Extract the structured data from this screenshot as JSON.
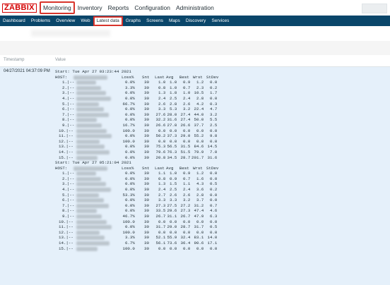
{
  "app": {
    "logo": "ZABBIX"
  },
  "top_menu": [
    "Monitoring",
    "Inventory",
    "Reports",
    "Configuration",
    "Administration"
  ],
  "sub_menu": [
    "Dashboard",
    "Problems",
    "Overview",
    "Web",
    "Latest data",
    "Graphs",
    "Screens",
    "Maps",
    "Discovery",
    "Services"
  ],
  "table": {
    "headers": [
      "Timestamp",
      "Value"
    ],
    "timestamp": "04/27/2021 04:37:09 PM"
  },
  "report": {
    "columns_header": {
      "host": "HOST:",
      "loss": "Loss%",
      "snt": "Snt",
      "last": "Last",
      "avg": "Avg",
      "best": "Best",
      "wrst": "Wrst",
      "stdev": "StDev"
    },
    "blocks": [
      {
        "start": "Start: Tue Apr 27 03:23:44 2021",
        "rows": [
          [
            "1.|--",
            "0.0%",
            "30",
            "1.0",
            "1.0",
            "0.9",
            "1.2",
            "0.0"
          ],
          [
            "2.|--",
            "3.3%",
            "30",
            "0.8",
            "1.0",
            "0.7",
            "2.3",
            "0.2"
          ],
          [
            "3.|--",
            "0.0%",
            "30",
            "1.3",
            "1.8",
            "1.0",
            "10.5",
            "1.7"
          ],
          [
            "4.|--",
            "0.0%",
            "30",
            "2.4",
            "2.5",
            "2.4",
            "2.8",
            "0.0"
          ],
          [
            "5.|--",
            "66.7%",
            "30",
            "2.6",
            "2.8",
            "2.6",
            "4.2",
            "0.3"
          ],
          [
            "6.|--",
            "0.0%",
            "30",
            "3.3",
            "5.3",
            "3.2",
            "22.4",
            "4.7"
          ],
          [
            "7.|--",
            "0.0%",
            "30",
            "27.6",
            "28.0",
            "27.4",
            "44.0",
            "3.2"
          ],
          [
            "8.|--",
            "0.0%",
            "30",
            "32.2",
            "31.6",
            "27.4",
            "50.0",
            "5.5"
          ],
          [
            "9.|--",
            "16.7%",
            "30",
            "26.6",
            "27.8",
            "26.6",
            "37.7",
            "2.5"
          ],
          [
            "10.|--",
            "100.0",
            "30",
            "0.0",
            "0.0",
            "0.0",
            "0.0",
            "0.0"
          ],
          [
            "11.|--",
            "0.0%",
            "30",
            "50.2",
            "37.3",
            "29.0",
            "55.2",
            "9.8"
          ],
          [
            "12.|--",
            "100.0",
            "30",
            "0.0",
            "0.0",
            "0.0",
            "0.0",
            "0.0"
          ],
          [
            "13.|--",
            "0.0%",
            "30",
            "75.3",
            "56.5",
            "31.5",
            "84.6",
            "14.5"
          ],
          [
            "14.|--",
            "0.0%",
            "30",
            "79.6",
            "76.3",
            "51.5",
            "79.9",
            "7.0"
          ],
          [
            "15.|--",
            "0.0%",
            "30",
            "20.8",
            "34.5",
            "28.7",
            "201.7",
            "31.6"
          ]
        ]
      },
      {
        "start": "Start: Tue Apr 27 05:21:04 2021",
        "rows": [
          [
            "1.|--",
            "0.0%",
            "30",
            "1.1",
            "1.0",
            "0.9",
            "1.2",
            "0.0"
          ],
          [
            "2.|--",
            "0.0%",
            "30",
            "0.8",
            "0.9",
            "0.7",
            "1.6",
            "0.0"
          ],
          [
            "3.|--",
            "0.0%",
            "30",
            "1.3",
            "1.5",
            "1.1",
            "4.3",
            "0.5"
          ],
          [
            "4.|--",
            "0.0%",
            "30",
            "2.4",
            "2.5",
            "2.4",
            "3.6",
            "0.2"
          ],
          [
            "5.|--",
            "53.3%",
            "30",
            "2.7",
            "2.6",
            "2.6",
            "2.8",
            "0.0"
          ],
          [
            "6.|--",
            "0.0%",
            "30",
            "3.3",
            "3.3",
            "3.2",
            "3.7",
            "0.0"
          ],
          [
            "7.|--",
            "0.0%",
            "30",
            "27.3",
            "27.5",
            "27.2",
            "31.2",
            "0.7"
          ],
          [
            "8.|--",
            "0.0%",
            "30",
            "33.5",
            "29.6",
            "27.3",
            "47.4",
            "4.6"
          ],
          [
            "9.|--",
            "46.7%",
            "30",
            "26.7",
            "31.1",
            "26.7",
            "47.9",
            "6.3"
          ],
          [
            "10.|--",
            "100.0",
            "30",
            "0.0",
            "0.0",
            "0.0",
            "0.0",
            "0.0"
          ],
          [
            "11.|--",
            "0.0%",
            "30",
            "31.7",
            "29.0",
            "28.7",
            "31.7",
            "0.5"
          ],
          [
            "12.|--",
            "100.0",
            "30",
            "0.0",
            "0.0",
            "0.0",
            "0.0",
            "0.0"
          ],
          [
            "13.|--",
            "3.3%",
            "30",
            "52.1",
            "55.9",
            "32.4",
            "83.1",
            "14.0"
          ],
          [
            "14.|--",
            "6.7%",
            "30",
            "56.1",
            "73.6",
            "36.4",
            "90.6",
            "17.1"
          ],
          [
            "15.|--",
            "100.0",
            "30",
            "0.0",
            "0.0",
            "0.0",
            "0.0",
            "0.0"
          ]
        ]
      }
    ]
  },
  "colors": {
    "brand": "#d40000",
    "nav": "#0a466a",
    "row_bg": "#e5f0fa",
    "highlight": "#d8342b"
  }
}
